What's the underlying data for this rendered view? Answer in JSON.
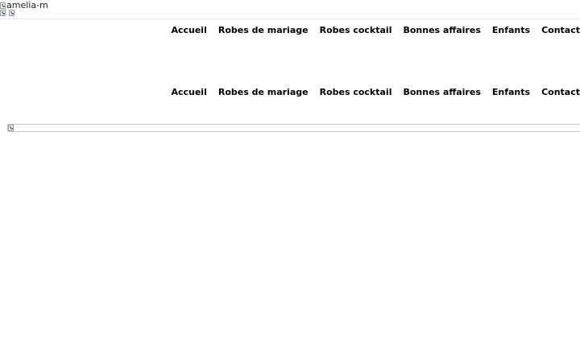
{
  "header": {
    "logo_alt": "amelia-m",
    "language_flags": [
      "flag-icon",
      "flag-icon"
    ]
  },
  "nav": {
    "items": [
      {
        "label": "Accueil"
      },
      {
        "label": "Robes de mariage"
      },
      {
        "label": "Robes cocktail"
      },
      {
        "label": "Bonnes affaires"
      },
      {
        "label": "Enfants"
      },
      {
        "label": "Contact"
      }
    ]
  },
  "banner": {
    "icon": "broken-image-icon"
  }
}
